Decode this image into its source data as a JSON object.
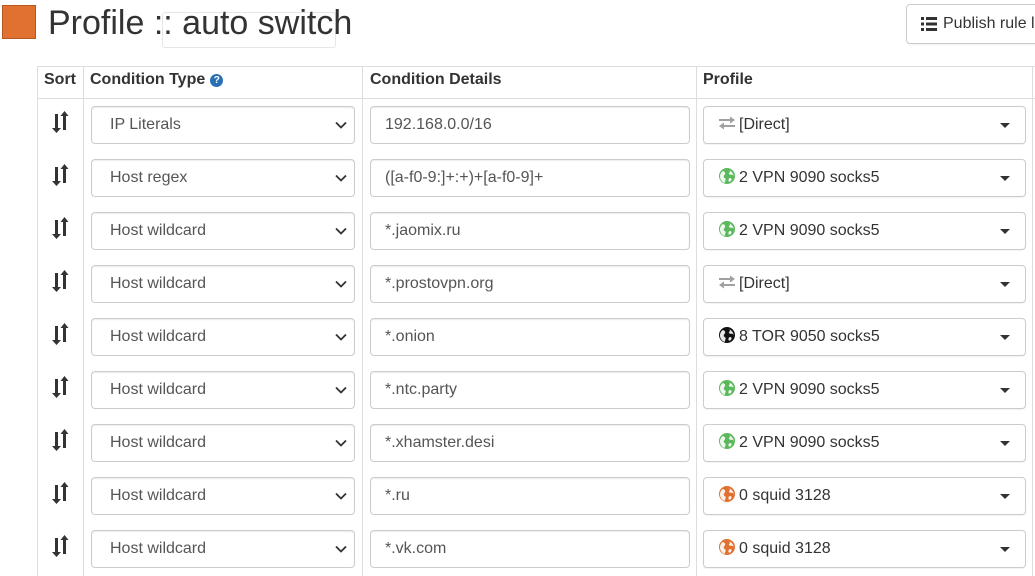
{
  "header": {
    "title": "Profile :: auto switch",
    "profile_color": "#e07131",
    "publish_button": "Publish rule l"
  },
  "table": {
    "columns": [
      "Sort",
      "Condition Type",
      "Condition Details",
      "Profile"
    ],
    "help_icon": "question-circle-icon",
    "rows": [
      {
        "condition_type": "IP Literals",
        "details": "192.168.0.0/16",
        "profile": "[Direct]",
        "profile_icon": "direct-transfer-icon",
        "profile_icon_color": "#a0a0a0"
      },
      {
        "condition_type": "Host regex",
        "details": "([a-f0-9:]+:+)+[a-f0-9]+",
        "profile": "2 VPN 9090 socks5",
        "profile_icon": "globe-icon",
        "profile_icon_color": "#5cb85c"
      },
      {
        "condition_type": "Host wildcard",
        "details": "*.jaomix.ru",
        "profile": "2 VPN 9090 socks5",
        "profile_icon": "globe-icon",
        "profile_icon_color": "#5cb85c"
      },
      {
        "condition_type": "Host wildcard",
        "details": "*.prostovpn.org",
        "profile": "[Direct]",
        "profile_icon": "direct-transfer-icon",
        "profile_icon_color": "#a0a0a0"
      },
      {
        "condition_type": "Host wildcard",
        "details": "*.onion",
        "profile": "8 TOR 9050 socks5",
        "profile_icon": "globe-icon",
        "profile_icon_color": "#111111"
      },
      {
        "condition_type": "Host wildcard",
        "details": "*.ntc.party",
        "profile": "2 VPN 9090 socks5",
        "profile_icon": "globe-icon",
        "profile_icon_color": "#5cb85c"
      },
      {
        "condition_type": "Host wildcard",
        "details": "*.xhamster.desi",
        "profile": "2 VPN 9090 socks5",
        "profile_icon": "globe-icon",
        "profile_icon_color": "#5cb85c"
      },
      {
        "condition_type": "Host wildcard",
        "details": "*.ru",
        "profile": "0 squid 3128",
        "profile_icon": "globe-icon",
        "profile_icon_color": "#e07131"
      },
      {
        "condition_type": "Host wildcard",
        "details": "*.vk.com",
        "profile": "0 squid 3128",
        "profile_icon": "globe-icon",
        "profile_icon_color": "#e07131"
      }
    ]
  }
}
